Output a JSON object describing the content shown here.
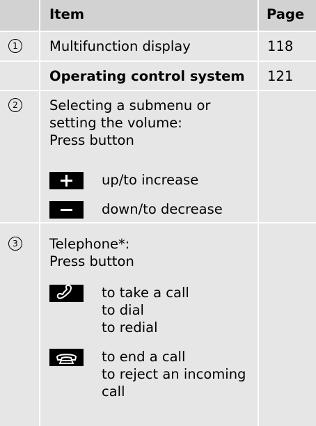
{
  "header": {
    "item_label": "Item",
    "page_label": "Page"
  },
  "rows": [
    {
      "number": "1",
      "text": "Multifunction display",
      "page": "118"
    },
    {
      "text": "Operating control system",
      "page": "121"
    },
    {
      "number": "2",
      "lines": [
        "Selecting a submenu or",
        "setting the volume:",
        "Press button"
      ],
      "keys": [
        {
          "icon": "plus-icon",
          "text": "up/to increase"
        },
        {
          "icon": "minus-icon",
          "text": "down/to decrease"
        }
      ]
    },
    {
      "number": "3",
      "lines": [
        "Telephone*:",
        "Press button"
      ],
      "keys": [
        {
          "icon": "phone-pickup-icon",
          "lines": [
            "to take a call",
            "to dial",
            "to redial"
          ]
        },
        {
          "icon": "phone-hangup-icon",
          "lines": [
            "to end a call",
            "to reject an incoming",
            "call"
          ]
        }
      ]
    }
  ],
  "colors": {
    "header_bg": "#d2d2d2",
    "body_bg": "#e6e6e6",
    "divider": "#ffffff"
  }
}
